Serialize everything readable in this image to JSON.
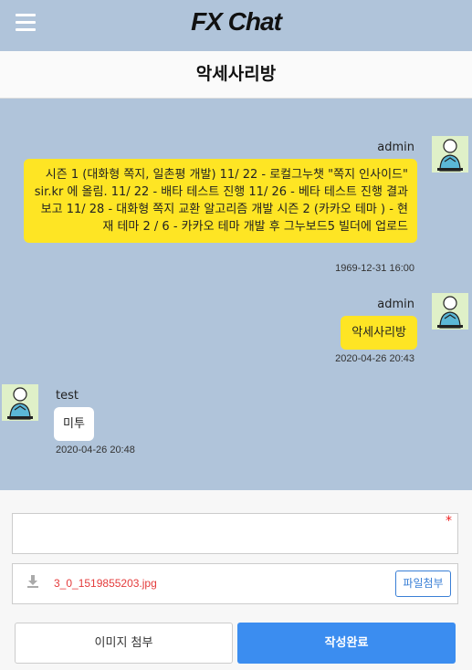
{
  "header": {
    "app_title": "FX Chat",
    "menu_icon": "hamburger-icon"
  },
  "room": {
    "title": "악세사리방"
  },
  "messages": [
    {
      "sender": "admin",
      "text": "시즌 1 (대화형 쪽지, 일촌평 개발) 11/ 22 - 로컬그누챗 \"쪽지 인사이드\" sir.kr 에 올림. 11/ 22 - 배타 테스트 진행 11/ 26 - 베타 테스트 진행 결과 보고 11/ 28 - 대화형 쪽지 교환 알고리즘 개발 시즌 2 (카카오 테마 ) - 현재 테마 2 / 6 - 카카오 테마 개발 후 그누보드5 빌더에 업로드",
      "time": "1969-12-31 16:00",
      "mine": true
    },
    {
      "sender": "admin",
      "text": "악세사리방",
      "time": "2020-04-26 20:43",
      "mine": true
    },
    {
      "sender": "test",
      "text": "미투",
      "time": "2020-04-26 20:48",
      "mine": false
    }
  ],
  "form": {
    "message_value": "",
    "required_mark": "*",
    "file_name": "3_0_1519855203.jpg",
    "attach_file_label": "파일첨부",
    "attach_image_label": "이미지 첨부",
    "submit_label": "작성완료"
  },
  "colors": {
    "header_bg": "#b0c4da",
    "my_bubble": "#fee524",
    "submit_button": "#3b8df0"
  }
}
